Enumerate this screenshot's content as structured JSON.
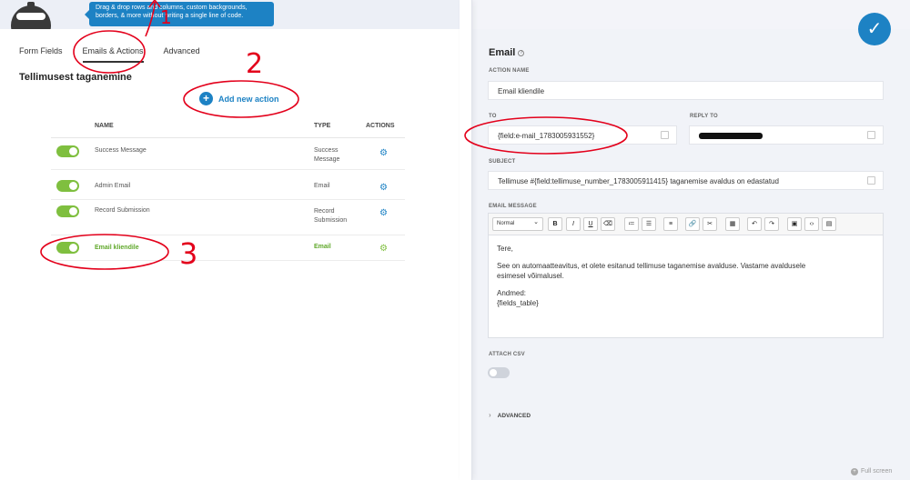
{
  "tooltip": {
    "line1": "Drag & drop rows and columns, custom backgrounds,",
    "line2": "borders, & more without writing a single line of code."
  },
  "tabs": [
    {
      "label": "Form Fields",
      "active": false
    },
    {
      "label": "Emails & Actions",
      "active": true
    },
    {
      "label": "Advanced",
      "active": false
    }
  ],
  "heading": "Tellimusest taganemine",
  "add_action_label": "Add new action",
  "table": {
    "headers": {
      "name": "NAME",
      "type": "TYPE",
      "actions": "ACTIONS"
    },
    "rows": [
      {
        "name": "Success Message",
        "type_line1": "Success",
        "type_line2": "Message"
      },
      {
        "name": "Admin Email",
        "type_line1": "Email",
        "type_line2": ""
      },
      {
        "name": "Record Submission",
        "type_line1": "Record",
        "type_line2": "Submission"
      },
      {
        "name": "Email kliendile",
        "type_line1": "Email",
        "type_line2": ""
      }
    ]
  },
  "panel": {
    "title": "Email",
    "action_name_label": "ACTION NAME",
    "action_name_value": "Email kliendile",
    "to_label": "TO",
    "to_value": "{field:e-mail_1783005931552}",
    "reply_to_label": "REPLY TO",
    "subject_label": "SUBJECT",
    "subject_value": "Tellimuse #{field:tellimuse_number_1783005911415} taganemise avaldus on edastatud",
    "message_label": "EMAIL MESSAGE",
    "format_select": "Normal",
    "message_lines": {
      "greeting": "Tere,",
      "body1": "See on automaatteavitus, et olete esitanud tellimuse taganemise avalduse. Vastame avaldusele",
      "body2": "esimesel võimalusel.",
      "data_title": "Andmed:",
      "data_field": "{fields_table}"
    },
    "attach_csv_label": "ATTACH CSV",
    "advanced_label": "ADVANCED",
    "fullscreen_label": "Full screen"
  },
  "annotations": {
    "one": "1",
    "two": "2",
    "three": "3"
  },
  "colors": {
    "accent": "#1d82c4",
    "toggle_on": "#7fbf3f",
    "annotation": "#e3001b"
  }
}
